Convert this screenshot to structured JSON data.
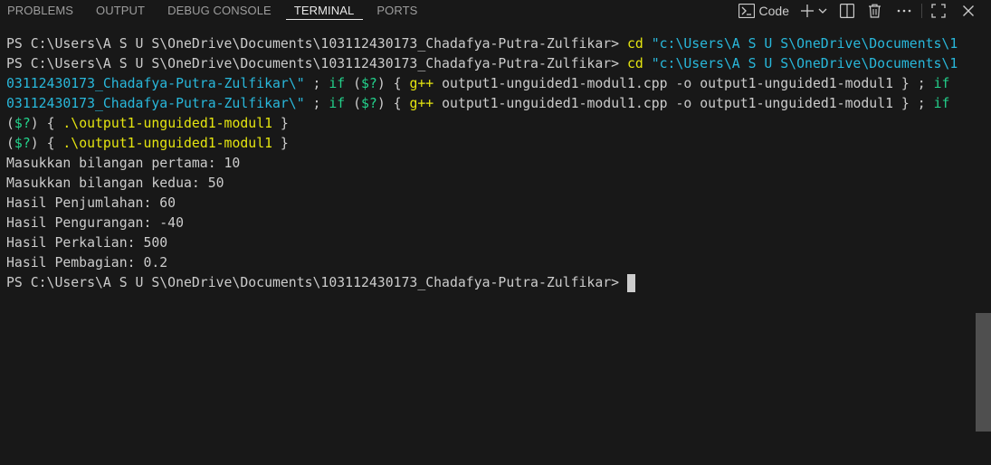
{
  "tabs": [
    {
      "label": "PROBLEMS",
      "active": false
    },
    {
      "label": "OUTPUT",
      "active": false
    },
    {
      "label": "DEBUG CONSOLE",
      "active": false
    },
    {
      "label": "TERMINAL",
      "active": true
    },
    {
      "label": "PORTS",
      "active": false
    }
  ],
  "actions": {
    "terminal_profile_label": "Code",
    "icons": [
      "terminal-icon",
      "plus-icon",
      "chevron-down-icon",
      "split-icon",
      "trash-icon",
      "ellipsis-icon",
      "maximize-icon",
      "close-icon"
    ]
  },
  "colors": {
    "background": "#181818",
    "text": "#cccccc",
    "command_yellow": "#e5e510",
    "string_cyan": "#29b8db",
    "variable_green": "#23d18b",
    "scrollbar": "#4f4f4f"
  },
  "terminal": {
    "prompt": "PS C:\\Users\\A S U S\\OneDrive\\Documents\\103112430173_Chadafya-Putra-Zulfikar>",
    "lines": {
      "l1_cmd": "cd",
      "l1_path": "\"c:\\Users\\A S U S\\OneDrive\\Documents\\1",
      "l3_path": "03112430173_Chadafya-Putra-Zulfikar\\\"",
      "l3_sep1": " ; ",
      "l3_if": "if",
      "l3_open": " (",
      "l3_var": "$?",
      "l3_close": ") { ",
      "l3_gpp": "g++",
      "l3_src": " output1-unguided1-modul1.cpp ",
      "l3_flag": "-o",
      "l3_out": " output1-unguided1-modul1 } ; ",
      "l3_if2": "if",
      "l5_open": "(",
      "l5_var": "$?",
      "l5_close": ") { ",
      "l5_exe": ".\\output1-unguided1-modul1",
      "l5_end": " }"
    },
    "output": [
      "Masukkan bilangan pertama: 10",
      "Masukkan bilangan kedua: 50",
      "Hasil Penjumlahan: 60",
      "Hasil Pengurangan: -40",
      "Hasil Perkalian: 500",
      "Hasil Pembagian: 0.2"
    ]
  }
}
